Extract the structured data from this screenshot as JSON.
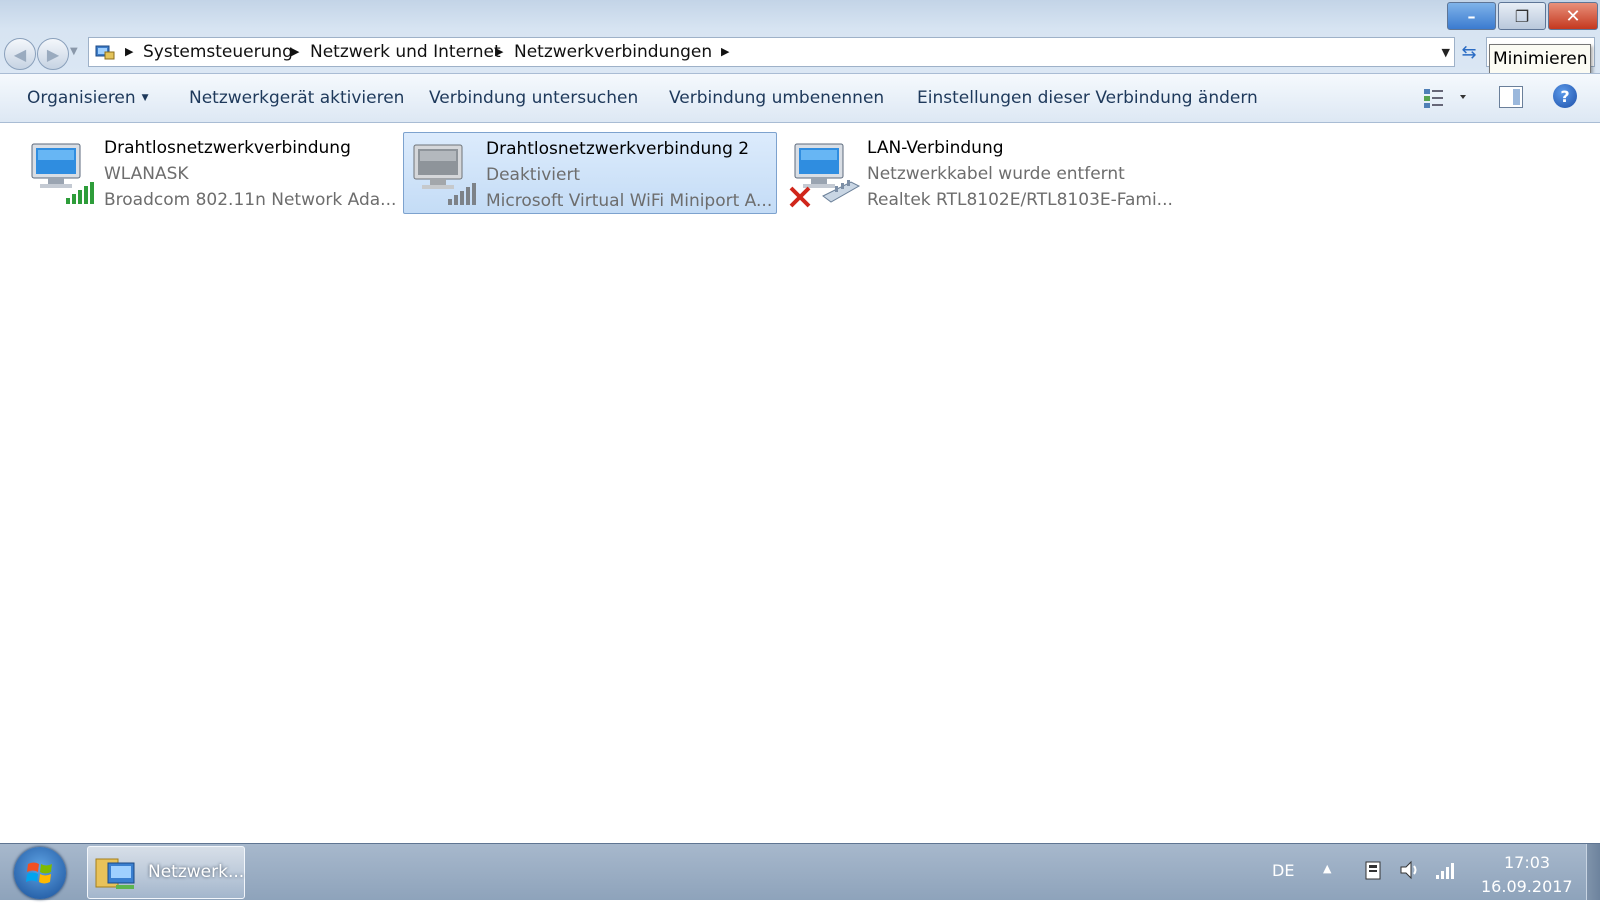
{
  "window": {
    "buttons": {
      "minimize": "–",
      "maximize": "❐",
      "close": "✕"
    },
    "tooltip": "Minimieren"
  },
  "navigation": {
    "back_icon": "back-arrow-icon",
    "forward_icon": "forward-arrow-icon"
  },
  "address_bar": {
    "icon": "control-panel-icon",
    "breadcrumbs": [
      "Systemsteuerung",
      "Netzwerk und Internet",
      "Netzwerkverbindungen"
    ]
  },
  "command_bar": {
    "organize": "Organisieren",
    "activate": "Netzwerkgerät aktivieren",
    "diagnose": "Verbindung untersuchen",
    "rename": "Verbindung umbenennen",
    "settings": "Einstellungen dieser Verbindung ändern",
    "help": "?"
  },
  "connections": [
    {
      "name": "Drahtlosnetzwerkverbindung",
      "status": "WLANASK",
      "adapter": "Broadcom 802.11n Network Ada...",
      "type": "wireless",
      "state": "connected",
      "selected": false
    },
    {
      "name": "Drahtlosnetzwerkverbindung 2",
      "status": "Deaktiviert",
      "adapter": "Microsoft Virtual WiFi Miniport A...",
      "type": "wireless",
      "state": "disabled",
      "selected": true
    },
    {
      "name": "LAN-Verbindung",
      "status": "Netzwerkkabel wurde entfernt",
      "adapter": "Realtek RTL8102E/RTL8103E-Fami...",
      "type": "ethernet",
      "state": "unplugged",
      "selected": false
    }
  ],
  "taskbar": {
    "task_label": "Netzwerk...",
    "language": "DE",
    "time": "17:03",
    "date": "16.09.2017"
  },
  "colors": {
    "selection": "#c4dcf6",
    "command_text": "#1e395b",
    "signal_green": "#2e9d3a",
    "error_red": "#d0261b"
  }
}
